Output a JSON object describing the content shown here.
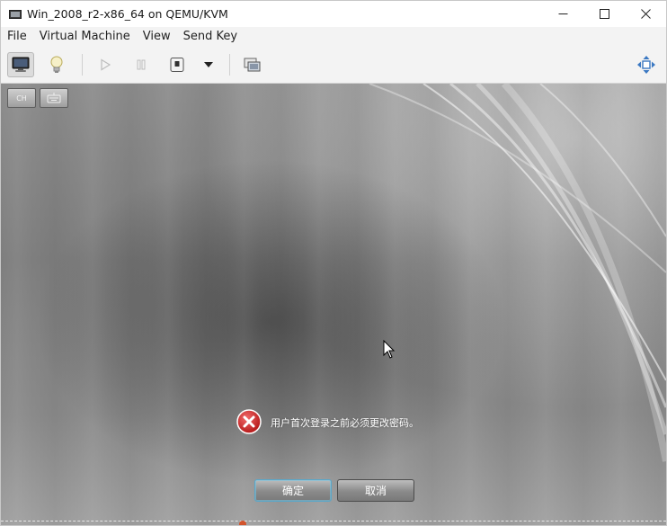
{
  "window": {
    "title": "Win_2008_r2-x86_64 on QEMU/KVM"
  },
  "menu": {
    "items": [
      "File",
      "Virtual Machine",
      "View",
      "Send Key"
    ]
  },
  "toolbar": {
    "icons": [
      "monitor-icon",
      "lightbulb-icon",
      "play-icon",
      "pause-icon",
      "shutdown-icon",
      "dropdown-arrow-icon",
      "screenshot-icon",
      "fullscreen-icon"
    ]
  },
  "guest": {
    "language_indicator": "CH",
    "message": "用户首次登录之前必须更改密码。",
    "ok_label": "确定",
    "cancel_label": "取消"
  },
  "colors": {
    "error_red": "#d12b2b",
    "ok_focus": "#5aa7c9"
  }
}
